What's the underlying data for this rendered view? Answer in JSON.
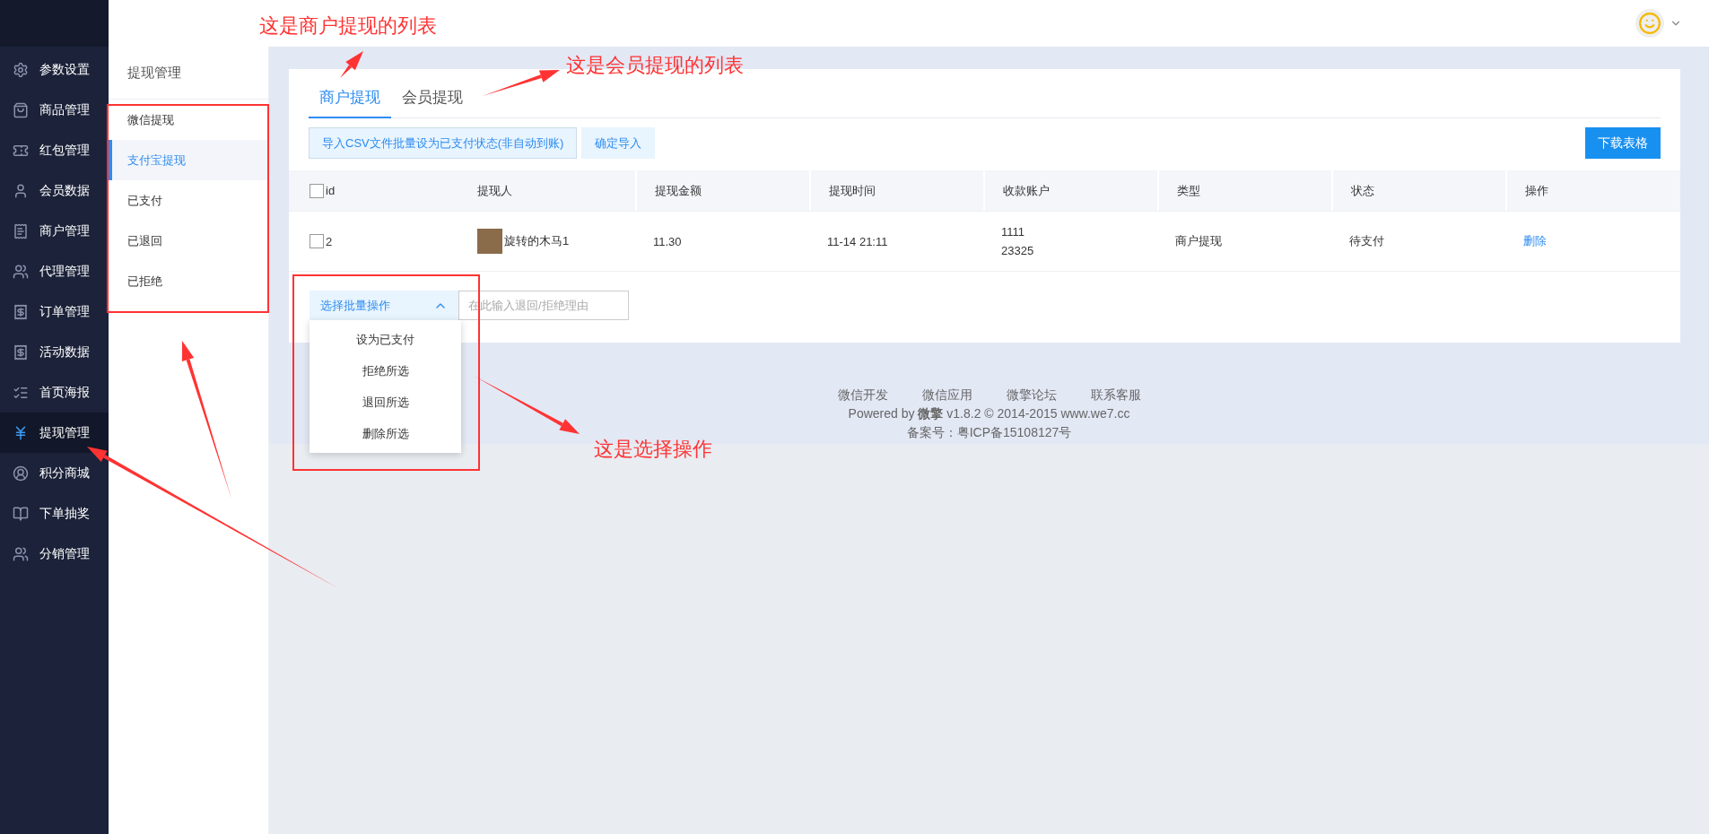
{
  "nav": {
    "items": [
      {
        "label": "参数设置",
        "selected": false
      },
      {
        "label": "商品管理",
        "selected": false
      },
      {
        "label": "红包管理",
        "selected": false
      },
      {
        "label": "会员数据",
        "selected": false
      },
      {
        "label": "商户管理",
        "selected": false
      },
      {
        "label": "代理管理",
        "selected": false
      },
      {
        "label": "订单管理",
        "selected": false
      },
      {
        "label": "活动数据",
        "selected": false
      },
      {
        "label": "首页海报",
        "selected": false
      },
      {
        "label": "提现管理",
        "selected": true
      },
      {
        "label": "积分商城",
        "selected": false
      },
      {
        "label": "下单抽奖",
        "selected": false
      },
      {
        "label": "分销管理",
        "selected": false
      }
    ]
  },
  "subnav": {
    "title": "提现管理",
    "items": [
      {
        "label": "微信提现",
        "selected": false
      },
      {
        "label": "支付宝提现",
        "selected": true
      },
      {
        "label": "已支付",
        "selected": false
      },
      {
        "label": "已退回",
        "selected": false
      },
      {
        "label": "已拒绝",
        "selected": false
      }
    ]
  },
  "tabs": [
    {
      "label": "商户提现",
      "selected": true
    },
    {
      "label": "会员提现",
      "selected": false
    }
  ],
  "toolbar": {
    "import_button": "导入CSV文件批量设为已支付状态(非自动到账)",
    "confirm_button": "确定导入",
    "download_button": "下载表格"
  },
  "table": {
    "columns": [
      "id",
      "提现人",
      "提现金额",
      "提现时间",
      "收款账户",
      "类型",
      "状态",
      "操作"
    ],
    "header_checked": false,
    "rows": [
      {
        "checked": false,
        "id": "2",
        "person": "旋转的木马1",
        "amount": "11.30",
        "time": "11-14 21:11",
        "account": [
          "1111",
          "23325"
        ],
        "type": "商户提现",
        "status": "待支付",
        "action": "删除"
      }
    ]
  },
  "batch": {
    "label": "选择批量操作",
    "expanded": true,
    "options": [
      "设为已支付",
      "拒绝所选",
      "退回所选",
      "删除所选"
    ],
    "reason_placeholder": "在此输入退回/拒绝理由"
  },
  "footer": {
    "links": [
      "微信开发",
      "微信应用",
      "微擎论坛",
      "联系客服"
    ],
    "powered": "Powered by **微擎** v1.8.2 © 2014-2015 www.we7.cc",
    "icp": "备案号：粤ICP备15108127号"
  },
  "annotations": [
    "这是商户提现的列表",
    "这是会员提现的列表",
    "这是选择操作"
  ]
}
